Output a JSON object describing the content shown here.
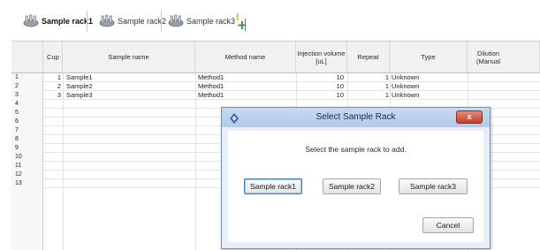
{
  "tabs": [
    {
      "label": "Sample rack1",
      "active": true
    },
    {
      "label": "Sample rack2",
      "active": false
    },
    {
      "label": "Sample rack3",
      "active": false
    }
  ],
  "table": {
    "headers": [
      "Cup",
      "Sample name",
      "Method name",
      "Injection volume\n[uL]",
      "Repeat",
      "Type",
      "Dilution\n(Manual"
    ],
    "row_numbers": [
      "1",
      "2",
      "3",
      "4",
      "5",
      "6",
      "7",
      "8",
      "9",
      "10",
      "11",
      "12",
      "13"
    ],
    "rows": [
      {
        "cup": "1",
        "sample_name": "Sample1",
        "method_name": "Method1",
        "injection_volume": "10",
        "repeat": "1",
        "type": "Unknown"
      },
      {
        "cup": "2",
        "sample_name": "Sample2",
        "method_name": "Method1",
        "injection_volume": "10",
        "repeat": "1",
        "type": "Unknown"
      },
      {
        "cup": "3",
        "sample_name": "Sample3",
        "method_name": "Method1",
        "injection_volume": "10",
        "repeat": "1",
        "type": "Unknown"
      }
    ]
  },
  "dialog": {
    "title": "Select Sample Rack",
    "prompt": "Select the sample rack to add.",
    "options": [
      "Sample rack1",
      "Sample rack2",
      "Sample rack3"
    ],
    "cancel_label": "Cancel",
    "close_label": "x"
  },
  "colors": {
    "dialog_close": "#c2412b",
    "focus_border": "#3c7fb1",
    "titlebar": "#b3c9e7"
  },
  "icons": {
    "rack_tab": "sample-rack-icon",
    "add_tab": "add-rack-icon",
    "app": "app-icon",
    "close": "close-icon"
  }
}
